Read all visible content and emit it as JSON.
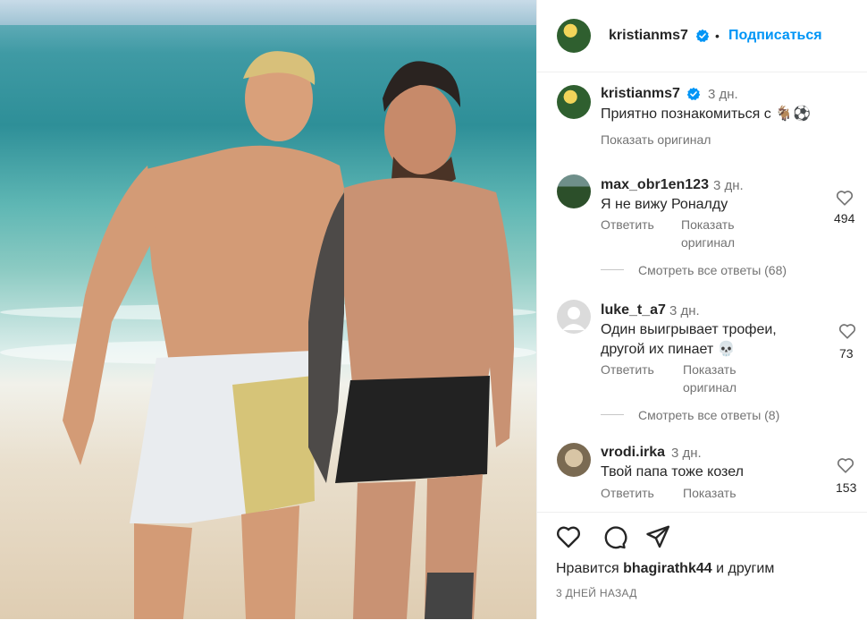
{
  "post": {
    "author": "kristianms7",
    "follow_label": "Подписаться",
    "dot": "•",
    "caption_time": "3 дн.",
    "caption_text": "Приятно познакомиться с 🐐⚽",
    "show_original": "Показать оригинал"
  },
  "comments": [
    {
      "username": "max_obr1en123",
      "time": "3 дн.",
      "text": "Я не вижу Роналду",
      "reply_label": "Ответить",
      "show_original": "Показать оригинал",
      "likes": "494",
      "view_replies": "Смотреть все ответы (68)"
    },
    {
      "username": "luke_t_a7",
      "time": "3 дн.",
      "text": "Один выигрывает трофеи, другой их пинает 💀",
      "reply_label": "Ответить",
      "show_original": "Показать оригинал",
      "likes": "73",
      "view_replies": "Смотреть все ответы (8)"
    },
    {
      "username": "vrodi.irka",
      "time": "3 дн.",
      "text": "Твой папа тоже козел",
      "reply_label": "Ответить",
      "show_original": "Показать",
      "likes": "153"
    }
  ],
  "footer": {
    "liked_prefix": "Нравится",
    "liked_user": "bhagirathk44",
    "liked_suffix": "и другим",
    "date": "3 ДНЕЙ НАЗАД"
  },
  "icons": {
    "verified": "verified-badge-icon",
    "heart": "heart-icon",
    "comment": "comment-icon",
    "share": "share-icon"
  },
  "colors": {
    "accent": "#0095f6",
    "verified": "#0095f6",
    "muted": "#737373"
  }
}
